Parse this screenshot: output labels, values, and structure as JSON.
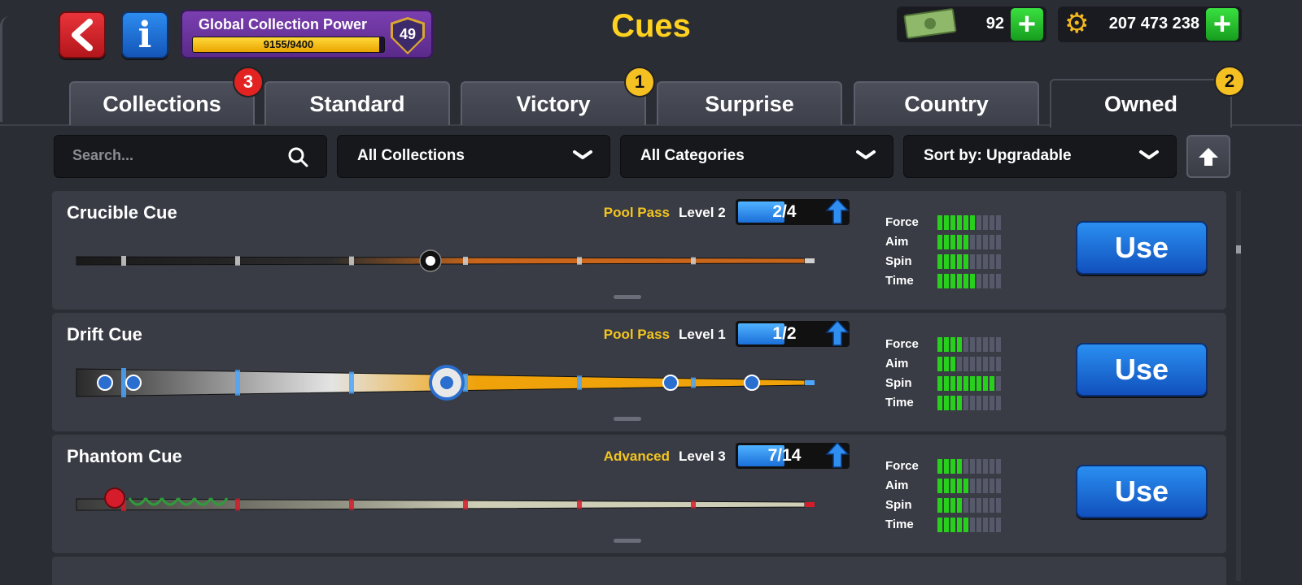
{
  "header": {
    "title": "Cues",
    "info_icon": "i",
    "global_power": {
      "label": "Global Collection Power",
      "value_text": "9155/9400",
      "current": 9155,
      "max": 9400,
      "level": "49"
    },
    "cash": {
      "value": "92",
      "icon": "cash-bill-icon"
    },
    "coins": {
      "value": "207 473 238",
      "icon": "gear-coin-icon"
    },
    "plus": "+"
  },
  "tabs": [
    {
      "label": "Collections",
      "badge": "3",
      "badge_color": "#e32222"
    },
    {
      "label": "Standard"
    },
    {
      "label": "Victory",
      "badge": "1",
      "badge_color": "#f5c021"
    },
    {
      "label": "Surprise"
    },
    {
      "label": "Country"
    },
    {
      "label": "Owned",
      "badge": "2",
      "badge_color": "#f5c021",
      "active": true
    }
  ],
  "filters": {
    "search_placeholder": "Search...",
    "collections": "All Collections",
    "categories": "All Categories",
    "sort": "Sort by: Upgradable"
  },
  "stat_labels": {
    "force": "Force",
    "aim": "Aim",
    "spin": "Spin",
    "time": "Time"
  },
  "cues": [
    {
      "name": "Crucible Cue",
      "source": "Pool Pass",
      "level": "Level 2",
      "progress_text": "2/4",
      "progress": 0.5,
      "stats": {
        "force": 6,
        "aim": 5,
        "spin": 5,
        "time": 6
      },
      "use_label": "Use"
    },
    {
      "name": "Drift Cue",
      "source": "Pool Pass",
      "level": "Level 1",
      "progress_text": "1/2",
      "progress": 0.5,
      "stats": {
        "force": 4,
        "aim": 3,
        "spin": 9,
        "time": 4
      },
      "use_label": "Use"
    },
    {
      "name": "Phantom Cue",
      "source": "Advanced",
      "level": "Level 3",
      "progress_text": "7/14",
      "progress": 0.5,
      "stats": {
        "force": 4,
        "aim": 5,
        "spin": 4,
        "time": 5
      },
      "use_label": "Use"
    }
  ],
  "stat_max": 10,
  "colors": {
    "accent_yellow": "#ffd21f",
    "stat_on": "#27d11b",
    "use_blue": "#1b6fd9"
  }
}
